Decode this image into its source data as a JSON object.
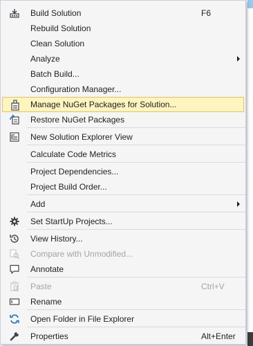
{
  "menu": {
    "items": [
      {
        "label": "Build Solution",
        "shortcut": "F6",
        "icon": "build-solution-icon"
      },
      {
        "label": "Rebuild Solution"
      },
      {
        "label": "Clean Solution"
      },
      {
        "label": "Analyze",
        "submenu": true
      },
      {
        "label": "Batch Build..."
      },
      {
        "label": "Configuration Manager..."
      },
      {
        "label": "Manage NuGet Packages for Solution...",
        "icon": "nuget-icon",
        "highlighted": true
      },
      {
        "label": "Restore NuGet Packages",
        "icon": "restore-nuget-icon"
      },
      {
        "label": "New Solution Explorer View",
        "icon": "new-explorer-view-icon"
      },
      {
        "label": "Calculate Code Metrics"
      },
      {
        "label": "Project Dependencies..."
      },
      {
        "label": "Project Build Order..."
      },
      {
        "label": "Add",
        "submenu": true
      },
      {
        "label": "Set StartUp Projects...",
        "icon": "gear-icon"
      },
      {
        "label": "View History...",
        "icon": "history-icon"
      },
      {
        "label": "Compare with Unmodified...",
        "icon": "compare-icon",
        "disabled": true
      },
      {
        "label": "Annotate",
        "icon": "annotate-icon"
      },
      {
        "label": "Paste",
        "shortcut": "Ctrl+V",
        "icon": "paste-icon",
        "disabled": true
      },
      {
        "label": "Rename",
        "icon": "rename-icon"
      },
      {
        "label": "Open Folder in File Explorer",
        "icon": "open-folder-icon"
      },
      {
        "label": "Properties",
        "shortcut": "Alt+Enter",
        "icon": "wrench-icon"
      }
    ]
  },
  "colors": {
    "menu_bg": "#f5f5f5",
    "highlight_bg": "#fdf4bf",
    "highlight_border": "#e5c365",
    "text": "#1e1e1e",
    "disabled_text": "#a2a4a5",
    "accent_blue": "#1e6fc0"
  }
}
